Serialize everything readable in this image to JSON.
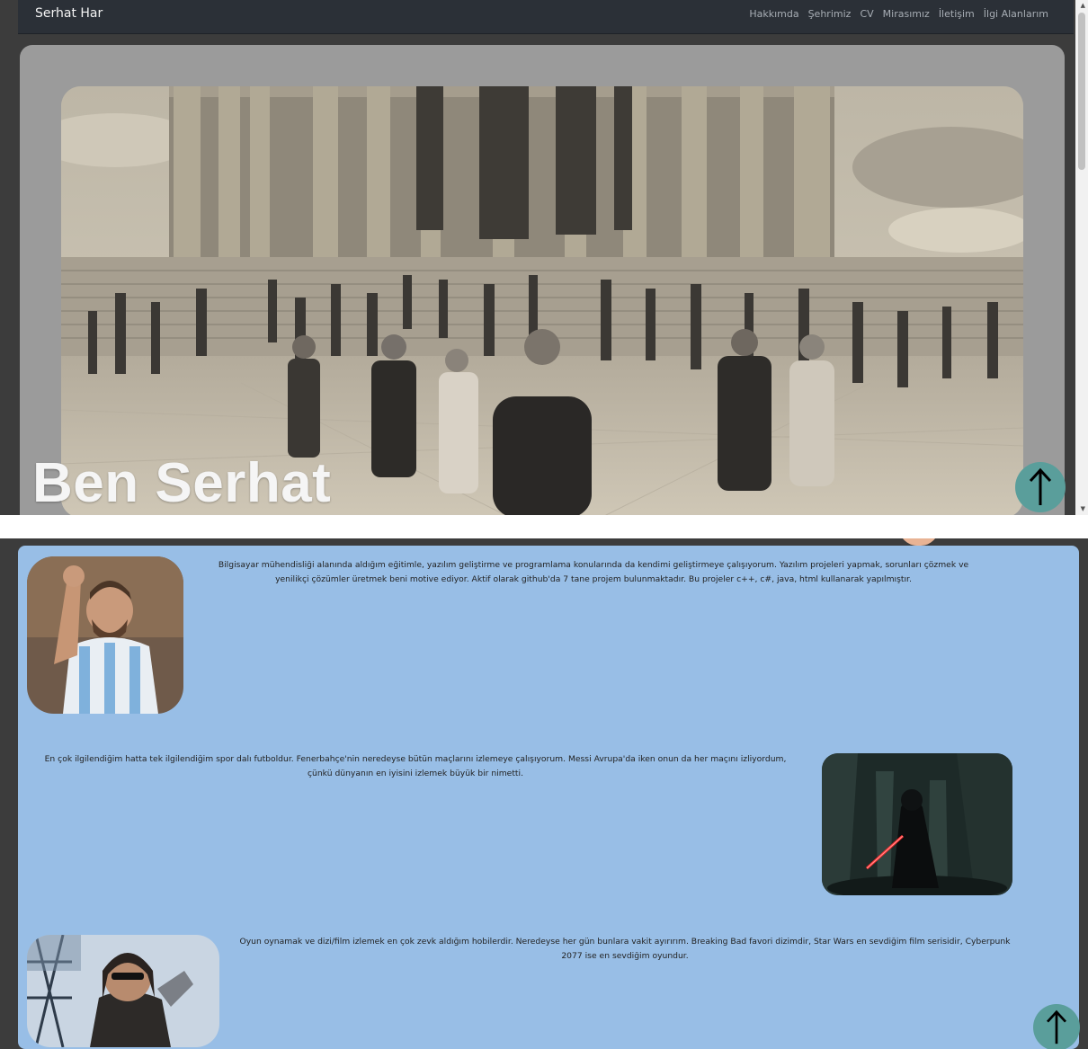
{
  "navbar": {
    "brand": "Serhat Har",
    "links": [
      "Hakkımda",
      "Şehrimiz",
      "CV",
      "Mirasımız",
      "İletişim",
      "İlgi Alanlarım"
    ]
  },
  "hero": {
    "title": "Ben Serhat"
  },
  "about": {
    "p1": "Bilgisayar mühendisliği alanında aldığım eğitimle, yazılım geliştirme ve programlama konularında da kendimi geliştirmeye çalışıyorum. Yazılım projeleri yapmak, sorunları çözmek ve yenilikçi çözümler üretmek beni motive ediyor. Aktif olarak github'da 7 tane projem bulunmaktadır. Bu projeler c++, c#, java, html kullanarak yapılmıştır.",
    "p2": "En çok ilgilendiğim hatta tek ilgilendiğim spor dalı futboldur. Fenerbahçe'nin neredeyse bütün maçlarını izlemeye çalışıyorum. Messi Avrupa'da iken onun da her maçını izliyordum, çünkü dünyanın en iyisini izlemek büyük bir nimetti.",
    "p3": "Oyun oynamak ve dizi/film izlemek en çok zevk aldığım hobilerdir. Neredeyse her gün bunlara vakit ayırırım. Breaking Bad favori dizimdir, Star Wars en sevdiğim film serisidir, Cyberpunk 2077 ise en sevdiğim oyundur."
  },
  "icons": {
    "up": "arrow-up-icon"
  },
  "colors": {
    "card_blue": "#98bee6",
    "up_button": "#5a9e9b",
    "navbar": "#2b3037"
  }
}
